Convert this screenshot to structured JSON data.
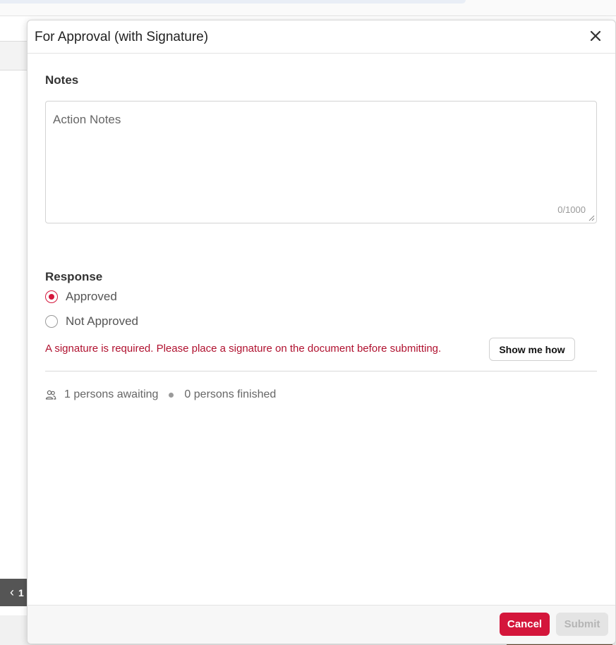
{
  "background": {
    "pager_chevron": "‹",
    "pager_page": "1"
  },
  "modal": {
    "title": "For Approval (with Signature)",
    "close_icon": "close-icon",
    "notes": {
      "label": "Notes",
      "placeholder": "Action Notes",
      "char_count": "0/1000"
    },
    "response": {
      "label": "Response",
      "options": [
        {
          "label": "Approved",
          "checked": true
        },
        {
          "label": "Not Approved",
          "checked": false
        }
      ]
    },
    "signature_error": "A signature is required. Please place a signature on the document before submitting.",
    "show_me_how_label": "Show me how",
    "status": {
      "awaiting": "1 persons awaiting",
      "finished": "0 persons finished"
    },
    "footer": {
      "cancel_label": "Cancel",
      "submit_label": "Submit",
      "submit_disabled": true
    }
  },
  "colors": {
    "accent": "#d4163b",
    "error_text": "#b0112f",
    "disabled_button": "#e4e4e4"
  }
}
